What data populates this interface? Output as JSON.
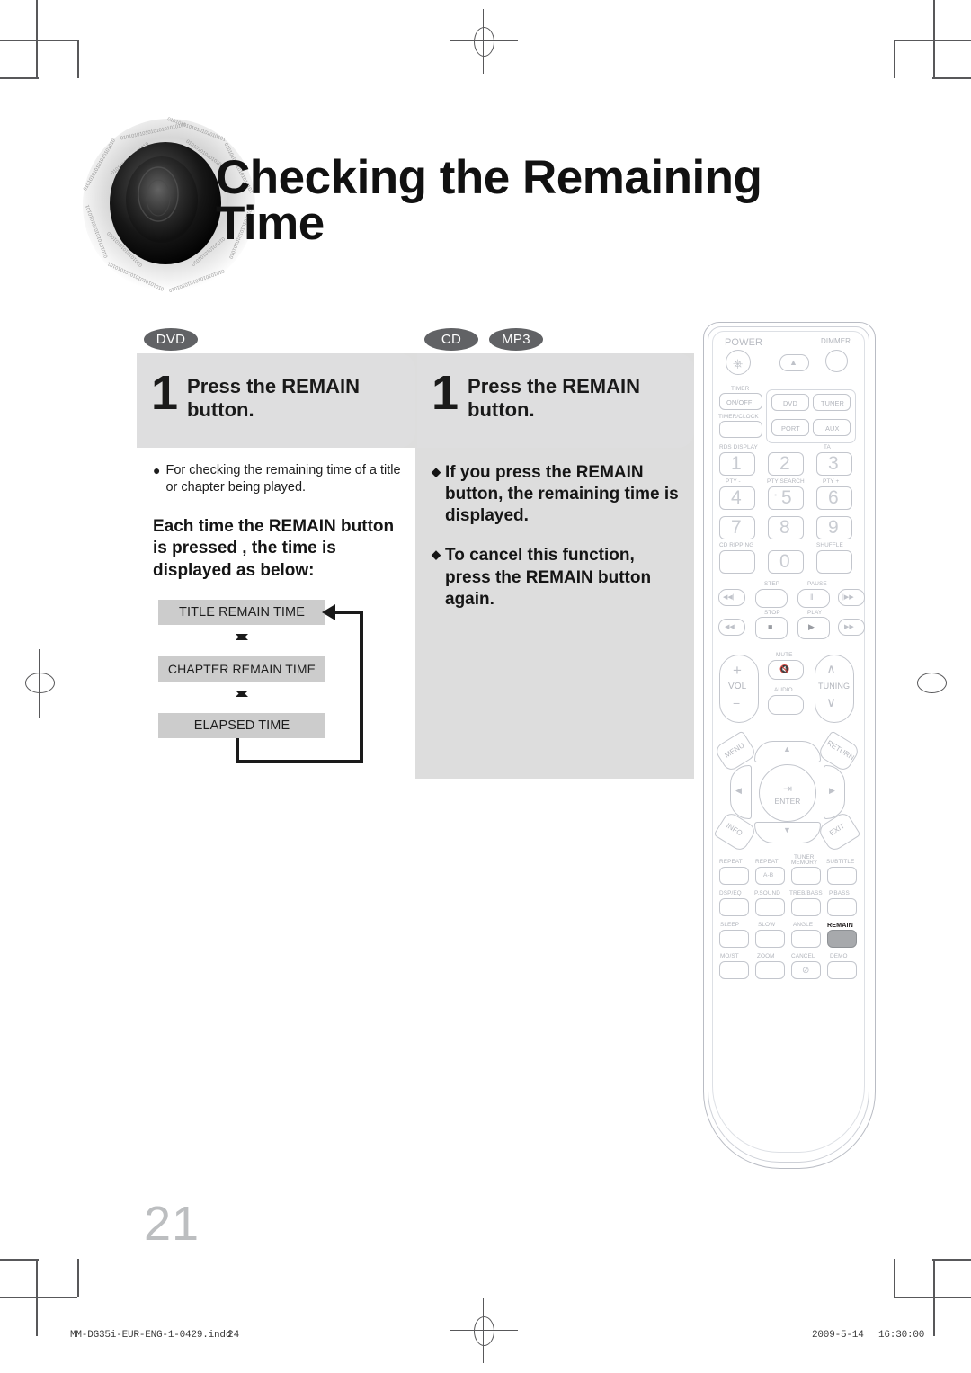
{
  "header": {
    "title_line1": "Checking the Remaining",
    "title_line2": "Time",
    "disc_icon": "dvd-disc-icon"
  },
  "columns": [
    {
      "id": "dvd",
      "badges": [
        "DVD"
      ],
      "step_number": "1",
      "step_title_line1": "Press the REMAIN",
      "step_title_line2": "button.",
      "bullet_note": "For checking the remaining time of a title or chapter being played.",
      "lead_text": "Each time the REMAIN button is pressed , the time is displayed as below:",
      "flow": {
        "type": "cycle",
        "steps": [
          "TITLE REMAIN TIME",
          "CHAPTER REMAIN TIME",
          "ELAPSED TIME"
        ],
        "loops_back_to": "TITLE REMAIN TIME"
      }
    },
    {
      "id": "cd-mp3",
      "badges": [
        "CD",
        "MP3"
      ],
      "step_number": "1",
      "step_title_line1": "Press the REMAIN",
      "step_title_line2": "button.",
      "notes": [
        "If you press the REMAIN button, the remaining time is displayed.",
        "To cancel this function, press the REMAIN button again."
      ]
    }
  ],
  "remote": {
    "name": "remote-control",
    "power_label": "POWER",
    "dimmer_label": "DIMMER",
    "eject_glyph": "▲",
    "timer_label": "TIMER",
    "on_off_label": "ON/OFF",
    "timer_clock_label": "TIMER/CLOCK",
    "source_buttons": [
      "DVD",
      "TUNER",
      "PORT",
      "AUX"
    ],
    "rds_display_label": "RDS DISPLAY",
    "ta_label": "TA",
    "pty_minus_label": "PTY -",
    "pty_search_label": "PTY SEARCH",
    "pty_plus_label": "PTY +",
    "cd_ripping_label": "CD RIPPING",
    "shuffle_label": "SHUFFLE",
    "numbers": [
      "1",
      "2",
      "3",
      "4",
      "5",
      "6",
      "7",
      "8",
      "9",
      "0"
    ],
    "step_label": "STEP",
    "pause_label": "PAUSE",
    "stop_label": "STOP",
    "play_label": "PLAY",
    "prev_glyph": "◀◀|",
    "next_glyph": "|▶▶",
    "rew_glyph": "◀◀",
    "ff_glyph": "▶▶",
    "pause_glyph": "‖",
    "stop_glyph": "■",
    "play_glyph": "▶",
    "vol_label": "VOL",
    "vol_plus": "+",
    "vol_minus": "−",
    "mute_label": "MUTE",
    "audio_label": "AUDIO",
    "tuning_label": "TUNING",
    "tuning_up": "∧",
    "tuning_down": "∨",
    "menu_label": "MENU",
    "return_label": "RETURN",
    "info_label": "INFO",
    "exit_label": "EXIT",
    "enter_label": "ENTER",
    "arrow_up": "▲",
    "arrow_down": "▼",
    "arrow_left": "◀",
    "arrow_right": "▶",
    "grid_labels": [
      "REPEAT",
      "REPEAT",
      "TUNER\nMEMORY",
      "SUBTITLE",
      "DSP/EQ",
      "P.SOUND",
      "TREB/BASS",
      "P.BASS",
      "SLEEP",
      "SLOW",
      "ANGLE",
      "REMAIN",
      "MO/ST",
      "ZOOM",
      "CANCEL",
      "DEMO"
    ],
    "repeat_ab_label": "A-B",
    "cancel_glyph": "⊘",
    "tuner_memory_line1": "TUNER",
    "tuner_memory_line2": "MEMORY",
    "highlighted_button": "REMAIN",
    "highlight_color": "#a7a9ac"
  },
  "page_number": "21",
  "footer": {
    "filename": "MM-DG35i-EUR-ENG-1-0429.indd",
    "sheet": "24",
    "date": "2009-5-14",
    "time": "16:30:00"
  }
}
